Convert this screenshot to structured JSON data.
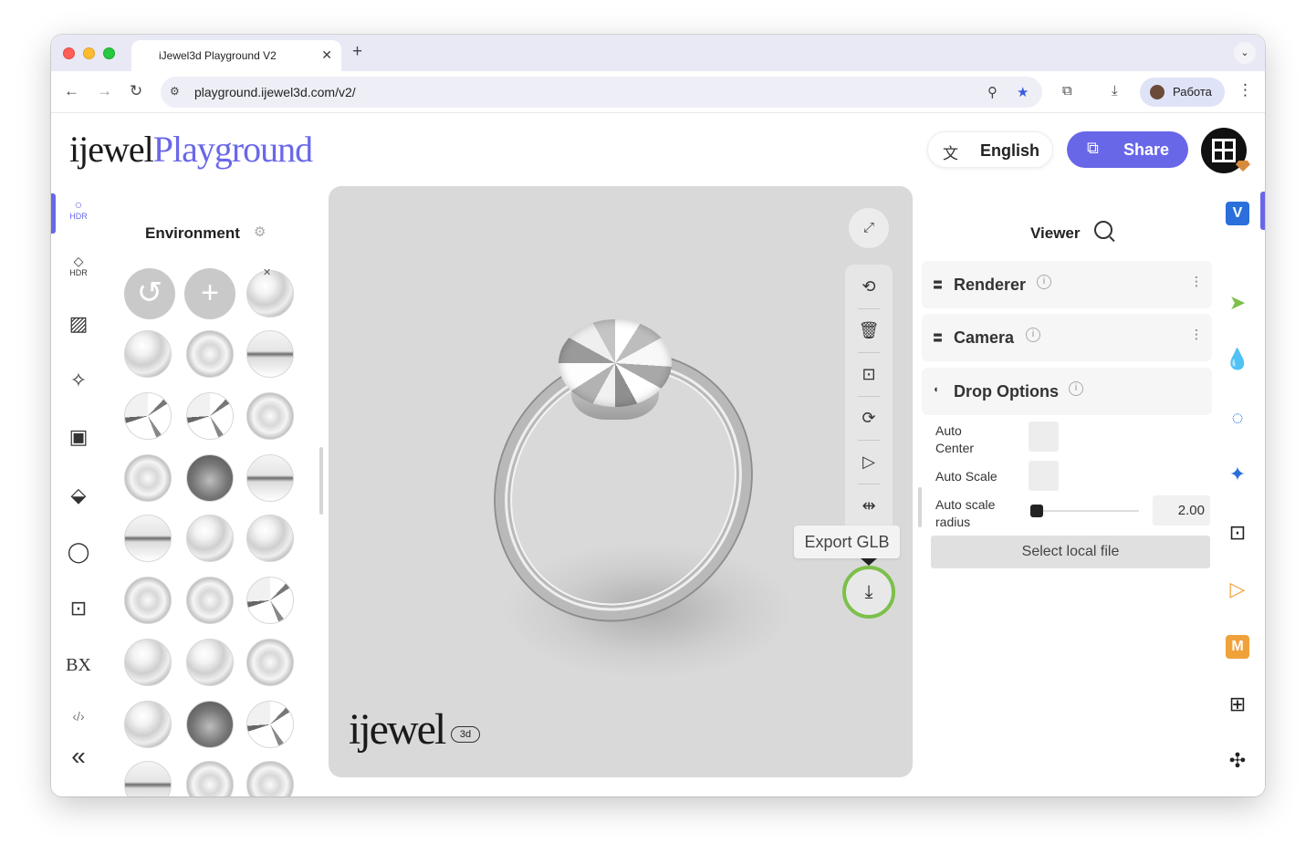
{
  "browser": {
    "tab_title": "iJewel3d Playground V2",
    "tab_close": "✕",
    "new_tab": "+",
    "tab_menu": "⌄",
    "url": "playground.ijewel3d.com/v2/",
    "profile_name": "Работа",
    "icons": [
      "back-icon",
      "forward-icon",
      "reload-icon",
      "site-settings-icon",
      "zoom-icon",
      "bookmark-star-icon",
      "extensions-icon",
      "downloads-icon",
      "more-icon"
    ]
  },
  "header": {
    "logo_part1": "ijewel",
    "logo_part2": "Playground",
    "language_label": "English",
    "share_label": "Share"
  },
  "left_rail": {
    "items": [
      {
        "icon": "hdr-icon",
        "label": "HDR"
      },
      {
        "icon": "diamond-hdr-icon",
        "label": "HDR"
      },
      {
        "icon": "stripes-icon",
        "label": ""
      },
      {
        "icon": "sparkle-icon",
        "label": ""
      },
      {
        "icon": "image-frame-icon",
        "label": ""
      },
      {
        "icon": "plane-icon",
        "label": ""
      },
      {
        "icon": "ring-icon",
        "label": ""
      },
      {
        "icon": "upload-box-icon",
        "label": ""
      },
      {
        "icon": "bx-icon",
        "label": "BX"
      },
      {
        "icon": "code-icon",
        "label": ""
      }
    ],
    "collapse_label": "«"
  },
  "environment": {
    "title": "Environment",
    "reset_label": "↺",
    "add_label": "+"
  },
  "viewport": {
    "tooltip": "Export GLB",
    "watermark": "ijewel",
    "watermark_badge": "3d"
  },
  "viewer": {
    "title": "Viewer",
    "sections": [
      {
        "label": "Renderer"
      },
      {
        "label": "Camera"
      },
      {
        "label": "Drop Options"
      }
    ],
    "info_glyph": "i",
    "menu_glyph": "⋮",
    "options": {
      "auto_center": "Auto\nCenter",
      "auto_scale": "Auto Scale",
      "auto_scale_radius": "Auto scale\nradius",
      "radius_value": "2.00"
    },
    "select_file_label": "Select local file"
  },
  "right_rail": {
    "v_label": "V",
    "m_label": "M",
    "v_color": "#2a6fdb",
    "m_color": "#f0a23a"
  },
  "colors": {
    "accent": "#6867e8",
    "export_highlight": "#7cc04a"
  }
}
